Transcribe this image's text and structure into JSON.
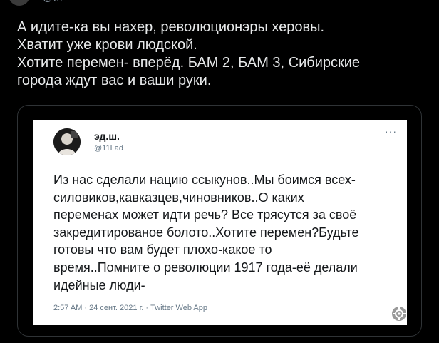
{
  "tweet": {
    "handle_partial": "@…",
    "text_lines": [
      "А идите-ка вы нахер, революционэры херовы.",
      "Хватит уже крови людской.",
      "Хотите перемен- вперёд. БАМ 2, БАМ 3, Сибирские",
      "города ждут  вас и ваши руки."
    ]
  },
  "media": {
    "embedded_tweet": {
      "display_name": "эд.ш.",
      "handle": "@11Lad",
      "more_icon": "more-icon",
      "body_lines": [
        "Из нас сделали нацию ссыкунов..Мы боимся всех-",
        "силовиков,кавказцев,чиновников..О каких",
        "переменах может идти речь? Все трясутся за своё",
        "закредитированое болото..Хотите перемен?Будьте",
        "готовы что вам будет плохо-какое то",
        "время..Помните о революции 1917 года-её делали",
        "идейные люди-"
      ],
      "meta": "2:57 AM · 24 сент. 2021 г. · Twitter Web App"
    },
    "overlay_icon": "gear-icon"
  },
  "colors": {
    "background": "#000000",
    "text": "#e7e9ea",
    "border": "#2f3336",
    "secondary": "#657786"
  }
}
